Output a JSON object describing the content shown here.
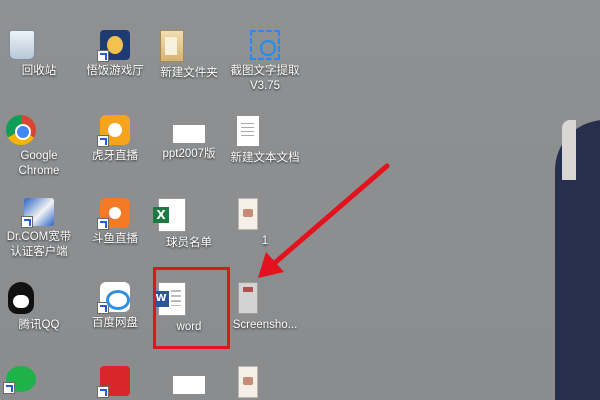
{
  "desktop": {
    "icons": [
      {
        "label": "回收站",
        "icon": "recycle-bin-icon"
      },
      {
        "label": "悟饭游戏厅",
        "icon": "game-hall-icon"
      },
      {
        "label": "新建文件夹",
        "icon": "folder-icon"
      },
      {
        "label": "截图文字提取",
        "label2": "V3.75",
        "icon": "ocr-capture-icon"
      },
      {
        "label": "Google",
        "label2": "Chrome",
        "icon": "chrome-icon"
      },
      {
        "label": "虎牙直播",
        "icon": "huya-icon"
      },
      {
        "label": "ppt2007版",
        "icon": "ppt-thumbnail-icon"
      },
      {
        "label": "新建文本文档",
        "icon": "text-document-icon"
      },
      {
        "label": "Dr.COM宽带",
        "label2": "认证客户端",
        "icon": "drcom-icon"
      },
      {
        "label": "斗鱼直播",
        "icon": "douyu-icon"
      },
      {
        "label": "球员名单",
        "icon": "excel-icon"
      },
      {
        "label": "1",
        "icon": "image-thumbnail-icon"
      },
      {
        "label": "腾讯QQ",
        "icon": "qq-icon"
      },
      {
        "label": "百度网盘",
        "icon": "baidu-netdisk-icon"
      },
      {
        "label": "word",
        "icon": "word-document-icon"
      },
      {
        "label": "Screensho...",
        "icon": "screenshot-file-icon"
      }
    ]
  },
  "annotation": {
    "highlight_color": "#e3121c",
    "arrow_color": "#e3121c"
  }
}
